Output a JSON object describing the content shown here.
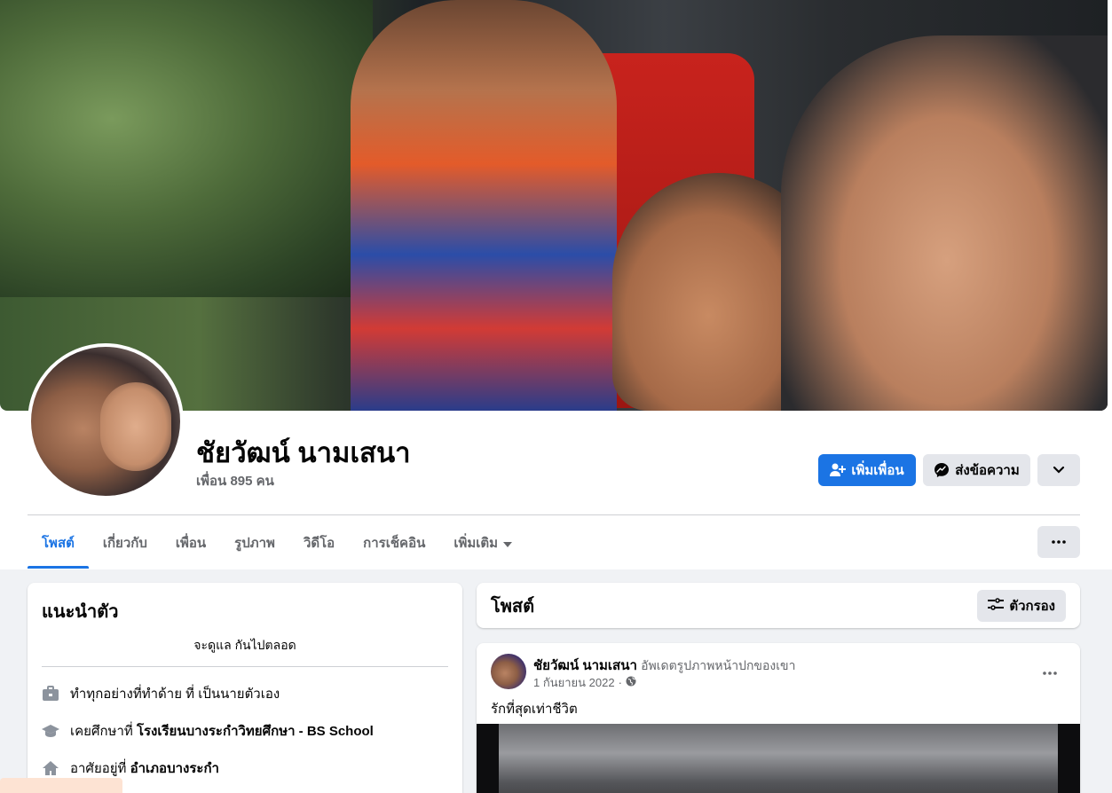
{
  "profile": {
    "name": "ชัยวัฒน์ นามเสนา",
    "friends": "เพื่อน 895 คน"
  },
  "actions": {
    "add_friend": "เพิ่มเพื่อน",
    "message": "ส่งข้อความ"
  },
  "tabs": [
    {
      "label": "โพสต์",
      "active": true
    },
    {
      "label": "เกี่ยวกับ"
    },
    {
      "label": "เพื่อน"
    },
    {
      "label": "รูปภาพ"
    },
    {
      "label": "วิดีโอ"
    },
    {
      "label": "การเช็คอิน"
    },
    {
      "label": "เพิ่มเติม"
    }
  ],
  "intro": {
    "title": "แนะนำตัว",
    "bio": "จะดูแล กันไปตลอด",
    "work": {
      "prefix": "ทำทุกอย่างที่ทำด้าย ที่ เป็นนายตัวเอง",
      "value": ""
    },
    "education": {
      "prefix": "เคยศึกษาที่",
      "value": "โรงเรียนบางระกำวิทยศึกษา - BS School"
    },
    "lives": {
      "prefix": "อาศัยอยู่ที่",
      "value": "อำเภอบางระกำ"
    }
  },
  "posts_header": {
    "title": "โพสต์",
    "filter": "ตัวกรอง"
  },
  "post": {
    "author": "ชัยวัฒน์ นามเสนา",
    "action": "อัพเดตรูปภาพหน้าปกของเขา",
    "date": "1 กันยายน 2022",
    "separator": "·",
    "text": "รักที่สุดเท่าชีวิต"
  },
  "colors": {
    "accent": "#1b74e4",
    "background": "#f0f2f5",
    "secondary_button": "#e4e6eb"
  }
}
